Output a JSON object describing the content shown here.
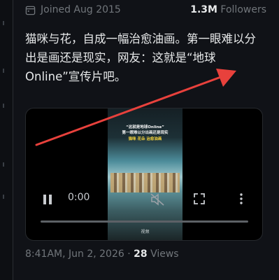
{
  "profile": {
    "joined": "Joined Aug 2015",
    "followers_count": "1.3M",
    "followers_label": "Followers"
  },
  "post": {
    "text": "猫咪与花，自成一幅治愈油画。第一眼难以分出是画还是现实，网友：这就是“地球Online”宣传片吧。"
  },
  "video": {
    "caption_top": "“这就是地球Online”",
    "caption_mid": "第一眼难以分出画还是现实",
    "caption_yellow": "猫咪 花朵 治愈油画",
    "watermark": "视频",
    "time": "0:00",
    "progress": 0.0,
    "controls": {
      "play_icon": "pause-icon",
      "mute_icon": "muted-speaker-icon",
      "expand_icon": "fullscreen-icon",
      "menu_icon": "more-vertical-icon"
    }
  },
  "footer": {
    "time_date": "8:41AM, Jun 2, 2026",
    "separator": "·",
    "views_count": "28",
    "views_label": "Views"
  },
  "annotation": {
    "color": "#e8413c",
    "icon": "red-arrow-annotation"
  }
}
